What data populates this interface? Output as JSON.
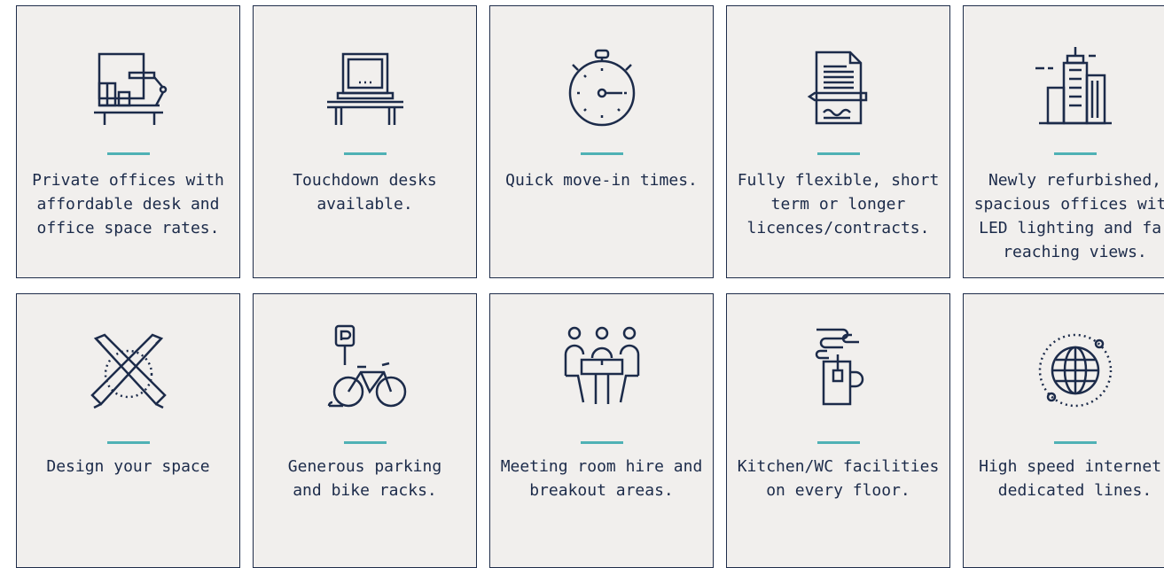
{
  "features_row1": [
    {
      "label": "Private offices with\naffordable desk and\noffice space rates.",
      "icon": "desk-lamp-office-icon"
    },
    {
      "label": "Touchdown desks\navailable.",
      "icon": "laptop-desk-icon"
    },
    {
      "label": "Quick move-in times.",
      "icon": "stopwatch-icon"
    },
    {
      "label": "Fully flexible, short\nterm or longer\nlicences/contracts.",
      "icon": "contract-pen-icon"
    },
    {
      "label": "Newly refurbished,\nspacious offices with\nLED lighting and far\nreaching views.",
      "icon": "buildings-icon"
    }
  ],
  "features_row2": [
    {
      "label": "Design your space",
      "icon": "crossed-pencils-icon"
    },
    {
      "label": "Generous parking\nand bike racks.",
      "icon": "parking-bike-icon"
    },
    {
      "label": "Meeting room hire and\nbreakout areas.",
      "icon": "meeting-table-icon"
    },
    {
      "label": "Kitchen/WC facilities\non every floor.",
      "icon": "tea-mug-icon"
    },
    {
      "label": "High speed internet,\ndedicated lines.",
      "icon": "globe-orbit-icon"
    }
  ],
  "colors": {
    "icon_stroke": "#1c2b4a",
    "accent": "#4fb1b5",
    "card_bg": "#f1efed"
  }
}
